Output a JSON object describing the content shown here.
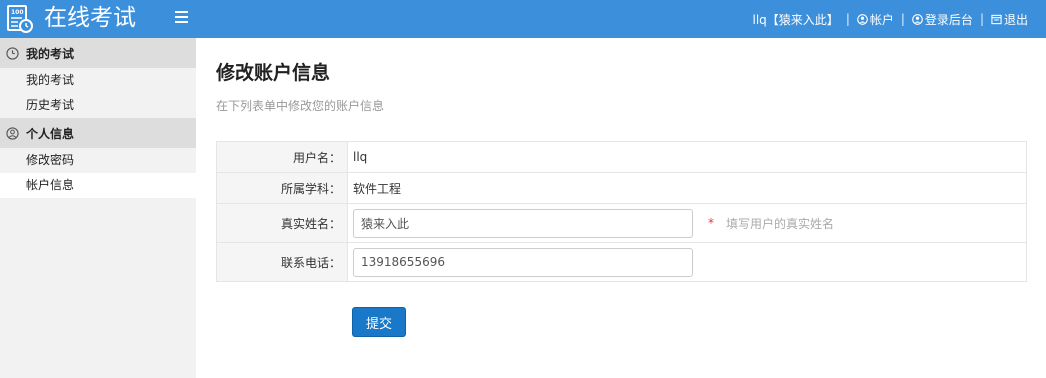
{
  "header": {
    "brand": "在线考试",
    "logo_icon": "exam-logo-icon",
    "menu_icon": "hamburger-icon",
    "user_label": "llq【猿来入此】",
    "account_label": "帐户",
    "backend_label": "登录后台",
    "logout_label": "退出",
    "separator": "|",
    "color": "#3b8fdb"
  },
  "sidebar": {
    "groups": [
      {
        "label": "我的考试",
        "icon": "clock-icon",
        "items": [
          {
            "label": "我的考试"
          },
          {
            "label": "历史考试"
          }
        ]
      },
      {
        "label": "个人信息",
        "icon": "user-circle-icon",
        "items": [
          {
            "label": "修改密码"
          },
          {
            "label": "帐户信息",
            "active": true
          }
        ]
      }
    ]
  },
  "main": {
    "title": "修改账户信息",
    "description": "在下列表单中修改您的账户信息",
    "form": {
      "username_label": "用户名：",
      "username_value": "llq",
      "subject_label": "所属学科：",
      "subject_value": "软件工程",
      "realname_label": "真实姓名：",
      "realname_value": "猿来入此",
      "realname_required": "*",
      "realname_hint": "填写用户的真实姓名",
      "phone_label": "联系电话：",
      "phone_value": "13918655696"
    },
    "submit_label": "提交"
  }
}
